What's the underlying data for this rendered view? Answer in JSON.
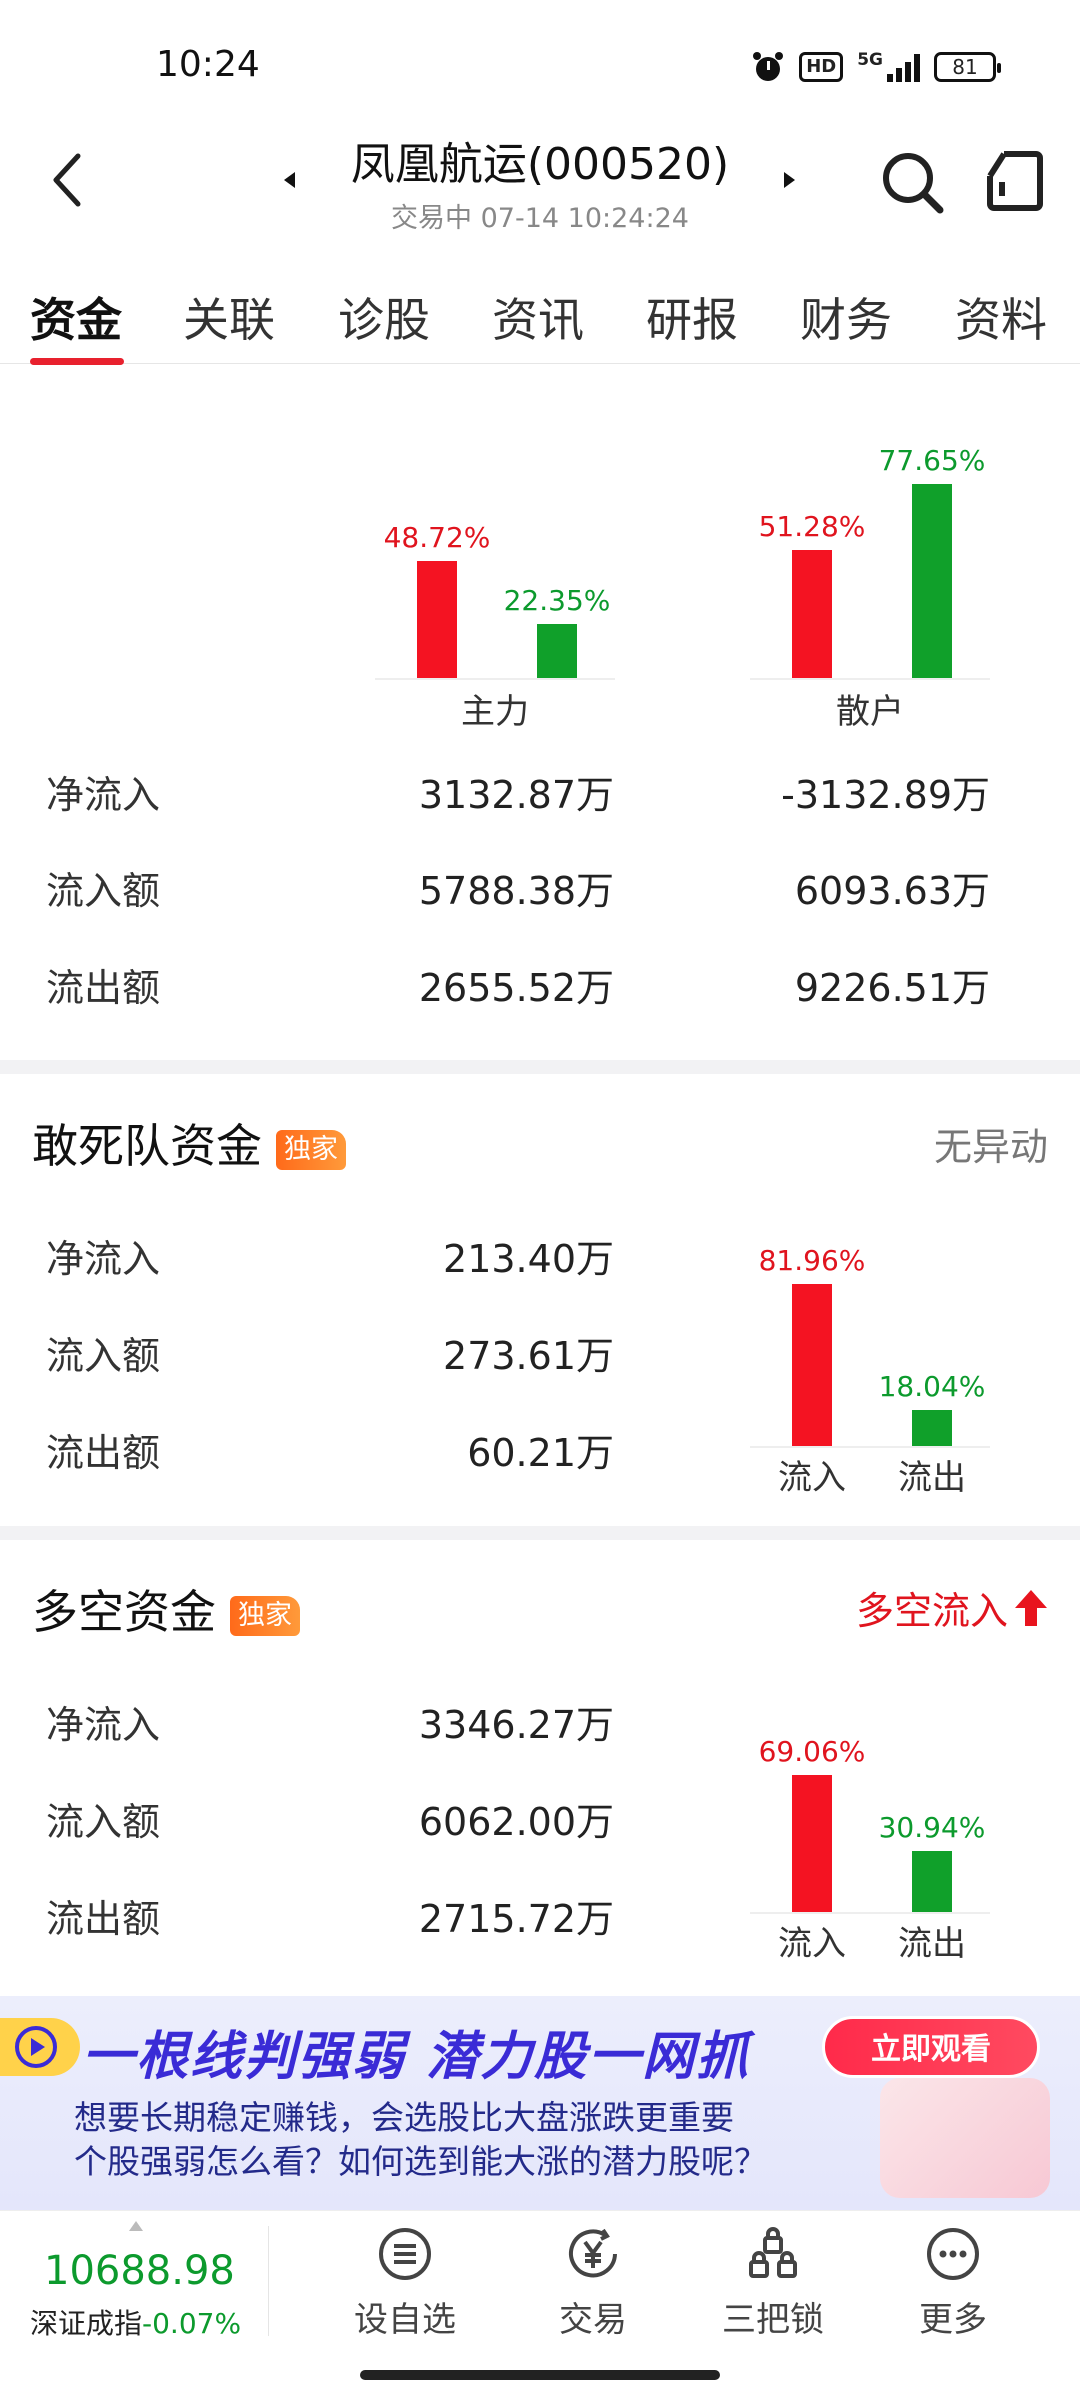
{
  "status_bar": {
    "time": "10:24",
    "network": "5G",
    "hd": "HD",
    "battery": "81"
  },
  "header": {
    "title": "凤凰航运(000520)",
    "subtitle": "交易中 07-14 10:24:24"
  },
  "tabs": [
    "资金",
    "关联",
    "诊股",
    "资讯",
    "研报",
    "财务",
    "资料"
  ],
  "fund_flow": {
    "chart": {
      "groups": [
        {
          "label": "主力",
          "inflow_pct": "48.72%",
          "outflow_pct": "22.35%",
          "inflow": 48.72,
          "outflow": 22.35
        },
        {
          "label": "散户",
          "inflow_pct": "51.28%",
          "outflow_pct": "77.65%",
          "inflow": 51.28,
          "outflow": 77.65
        }
      ]
    },
    "rows": [
      {
        "label": "净流入",
        "main": "3132.87万",
        "retail": "-3132.89万"
      },
      {
        "label": "流入额",
        "main": "5788.38万",
        "retail": "6093.63万"
      },
      {
        "label": "流出额",
        "main": "2655.52万",
        "retail": "9226.51万"
      }
    ]
  },
  "dare_fund": {
    "title": "敢死队资金",
    "badge": "独家",
    "status": "无异动",
    "rows": [
      {
        "label": "净流入",
        "value": "213.40万"
      },
      {
        "label": "流入额",
        "value": "273.61万"
      },
      {
        "label": "流出额",
        "value": "60.21万"
      }
    ],
    "chart": {
      "in_pct": "81.96%",
      "out_pct": "18.04%",
      "in": 81.96,
      "out": 18.04,
      "in_label": "流入",
      "out_label": "流出"
    }
  },
  "long_short_fund": {
    "title": "多空资金",
    "badge": "独家",
    "status": "多空流入",
    "rows": [
      {
        "label": "净流入",
        "value": "3346.27万"
      },
      {
        "label": "流入额",
        "value": "6062.00万"
      },
      {
        "label": "流出额",
        "value": "2715.72万"
      }
    ],
    "chart": {
      "in_pct": "69.06%",
      "out_pct": "30.94%",
      "in": 69.06,
      "out": 30.94,
      "in_label": "流入",
      "out_label": "流出"
    }
  },
  "banner": {
    "title": "一根线判强弱 潜力股一网抓",
    "button": "立即观看",
    "desc_line1": "想要长期稳定赚钱，会选股比大盘涨跌更重要",
    "desc_line2": "个股强弱怎么看？如何选到能大涨的潜力股呢？"
  },
  "bottom_nav": {
    "index_value": "10688.98",
    "index_name": "深证成指",
    "index_change": "-0.07%",
    "items": [
      {
        "label": "设自选",
        "icon": "list-icon"
      },
      {
        "label": "交易",
        "icon": "yen-icon"
      },
      {
        "label": "三把锁",
        "icon": "locks-icon"
      },
      {
        "label": "更多",
        "icon": "more-icon"
      }
    ]
  },
  "colors": {
    "red": "#e0141e",
    "green": "#0c9a2d",
    "accent": "#e8212e"
  }
}
